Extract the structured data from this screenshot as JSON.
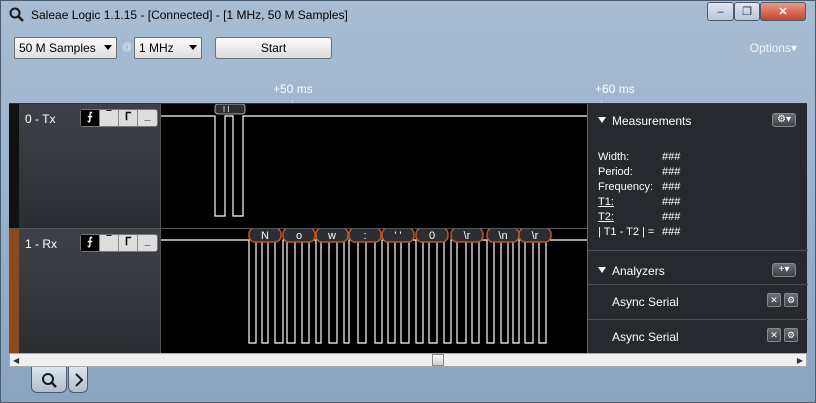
{
  "window": {
    "title": "Saleae Logic 1.1.15 - [Connected] - [1 MHz, 50 M Samples]",
    "minimize_label": "–",
    "restore_label": "❐",
    "close_label": "✕"
  },
  "toolbar": {
    "samples_value": "50 M Samples",
    "at_label": "@",
    "rate_value": "1 MHz",
    "start_label": "Start",
    "options_label": "Options▾"
  },
  "ruler": {
    "ticks": [
      "+50 ms",
      "+60 ms"
    ]
  },
  "channels": [
    {
      "id": "0",
      "label": "0 - Tx",
      "accent": "#111111"
    },
    {
      "id": "1",
      "label": "1 - Rx",
      "accent": "#8a4a1e"
    }
  ],
  "trigger_buttons": [
    "⌐",
    "¯",
    "⌐",
    "_"
  ],
  "rx_decodes": [
    "N",
    "o",
    "w",
    ":",
    "' '",
    "0",
    "\\r",
    "\\n",
    "\\r"
  ],
  "measurements": {
    "header": "Measurements",
    "rows": [
      {
        "label": "Width:",
        "value": "###"
      },
      {
        "label": "Period:",
        "value": "###"
      },
      {
        "label": "Frequency:",
        "value": "###"
      },
      {
        "label": "T1:",
        "value": "###"
      },
      {
        "label": "T2:",
        "value": "###"
      },
      {
        "label": "| T1 - T2 | =",
        "value": "###"
      }
    ]
  },
  "analyzers": {
    "header": "Analyzers",
    "items": [
      "Async Serial",
      "Async Serial"
    ]
  },
  "colors": {
    "signal": "#ffffff",
    "decode_bubble": "#c2551e"
  }
}
